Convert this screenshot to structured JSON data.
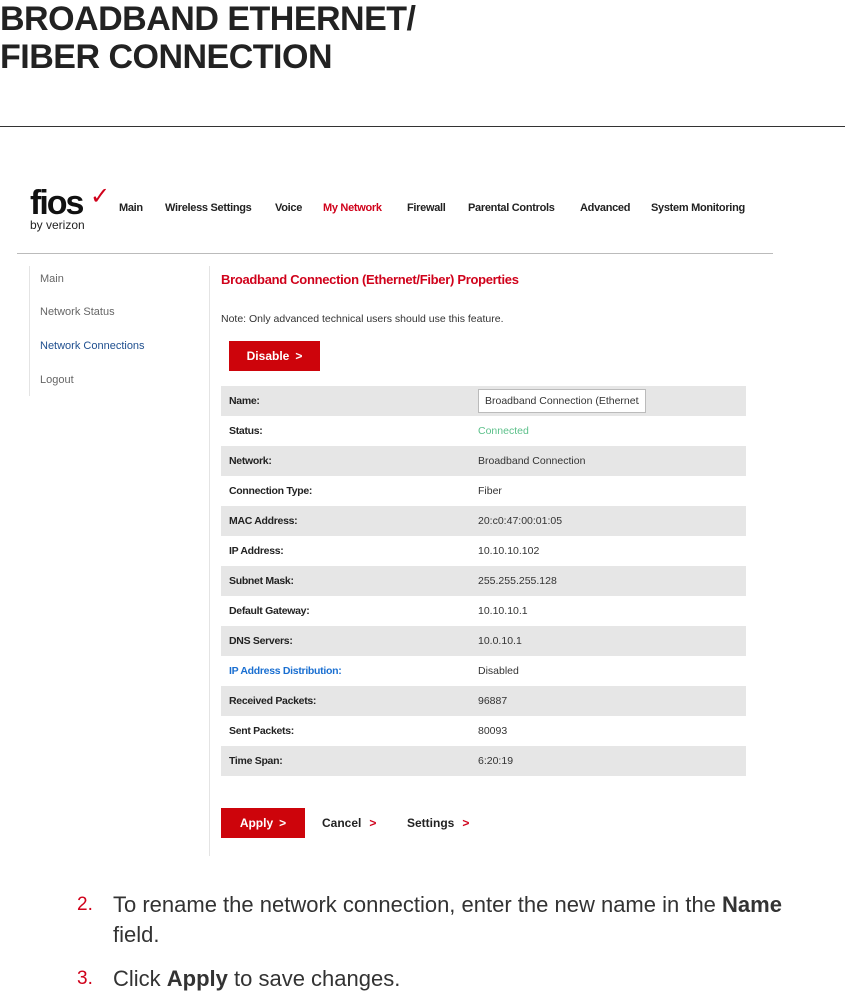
{
  "heading": {
    "line1": "BROADBAND ETHERNET/",
    "line2": "FIBER CONNECTION"
  },
  "logo": {
    "brand": "fios",
    "sub": "by verizon"
  },
  "nav": [
    "Main",
    "Wireless Settings",
    "Voice",
    "My Network",
    "Firewall",
    "Parental Controls",
    "Advanced",
    "System Monitoring"
  ],
  "nav_active": "My Network",
  "sidebar": [
    "Main",
    "Network Status",
    "Network Connections",
    "Logout"
  ],
  "page_title": "Broadband Connection (Ethernet/Fiber) Properties",
  "note": "Note: Only advanced technical users should use this feature.",
  "disable_label": "Disable",
  "rows": [
    {
      "label": "Name:",
      "value": "Broadband Connection (Ethernet/Fiber)"
    },
    {
      "label": "Status:",
      "value": "Connected"
    },
    {
      "label": "Network:",
      "value": "Broadband Connection"
    },
    {
      "label": "Connection Type:",
      "value": "Fiber"
    },
    {
      "label": "MAC Address:",
      "value": "20:c0:47:00:01:05"
    },
    {
      "label": "IP Address:",
      "value": "10.10.10.102"
    },
    {
      "label": "Subnet Mask:",
      "value": "255.255.255.128"
    },
    {
      "label": "Default Gateway:",
      "value": "10.10.10.1"
    },
    {
      "label": "DNS Servers:",
      "value": "10.0.10.1"
    },
    {
      "label": "IP Address Distribution:",
      "value": "Disabled"
    },
    {
      "label": "Received Packets:",
      "value": "96887"
    },
    {
      "label": "Sent Packets:",
      "value": "80093"
    },
    {
      "label": "Time Span:",
      "value": "6:20:19"
    }
  ],
  "actions": {
    "apply": "Apply",
    "cancel": "Cancel",
    "settings": "Settings"
  },
  "steps": [
    {
      "num": "2.",
      "pre": "To rename the network connection, enter the new name in the ",
      "bold": "Name",
      "post": " field."
    },
    {
      "num": "3.",
      "pre": "Click ",
      "bold": "Apply",
      "post": " to save changes."
    }
  ],
  "colors": {
    "accent": "#cd040b",
    "link": "#1a6fd1",
    "connected": "#5cc08a"
  }
}
